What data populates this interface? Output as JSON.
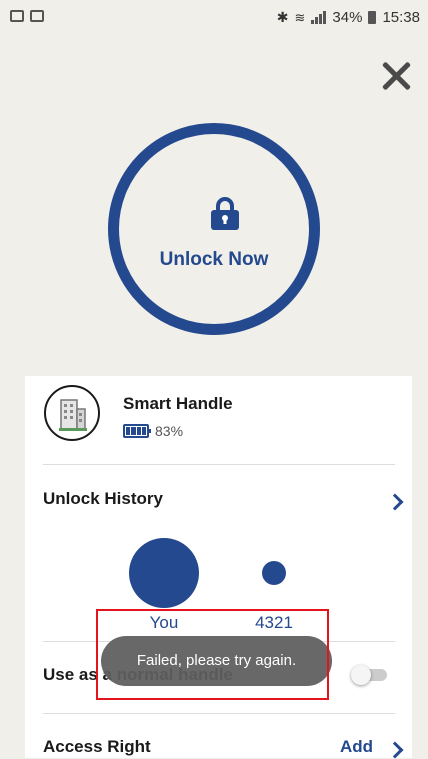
{
  "status_bar": {
    "battery_percent": "34%",
    "time": "15:38"
  },
  "unlock": {
    "label": "Unlock Now"
  },
  "device": {
    "name": "Smart Handle",
    "battery": "83%"
  },
  "history": {
    "title": "Unlock History",
    "users": [
      {
        "label": "You"
      },
      {
        "label": "4321"
      }
    ]
  },
  "normal_handle": {
    "label": "Use as a normal handle",
    "enabled": false
  },
  "access": {
    "title": "Access Right",
    "add_label": "Add"
  },
  "toast": {
    "message": "Failed, please try again."
  },
  "colors": {
    "accent": "#24498f",
    "background": "#f1efe9",
    "highlight": "#e5141c"
  }
}
